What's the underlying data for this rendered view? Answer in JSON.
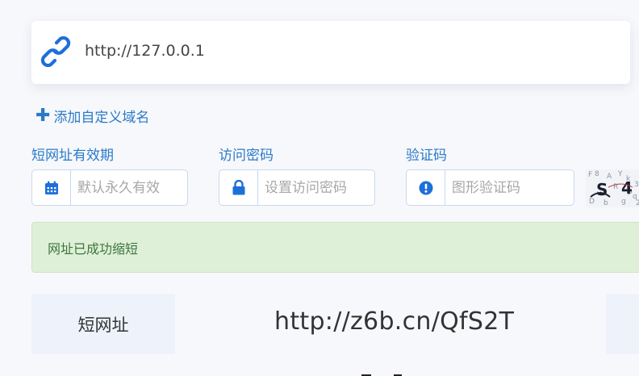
{
  "url_input": {
    "value": "http://127.0.0.1",
    "icon": "link-icon"
  },
  "add_domain": {
    "label": "添加自定义域名",
    "icon": "plus-icon"
  },
  "expiry": {
    "label": "短网址有效期",
    "placeholder": "默认永久有效",
    "icon": "calendar-icon"
  },
  "password": {
    "label": "访问密码",
    "placeholder": "设置访问密码",
    "icon": "lock-icon"
  },
  "captcha": {
    "label": "验证码",
    "placeholder": "图形验证码",
    "icon": "exclamation-circle-icon"
  },
  "alert": {
    "text": "网址已成功缩短"
  },
  "result": {
    "label": "短网址",
    "value": "http://z6b.cn/QfS2T"
  },
  "colors": {
    "accent": "#2a7ac8",
    "icon_blue": "#1e6fd9",
    "success_bg": "#dff0d8",
    "success_text": "#3c763d"
  }
}
